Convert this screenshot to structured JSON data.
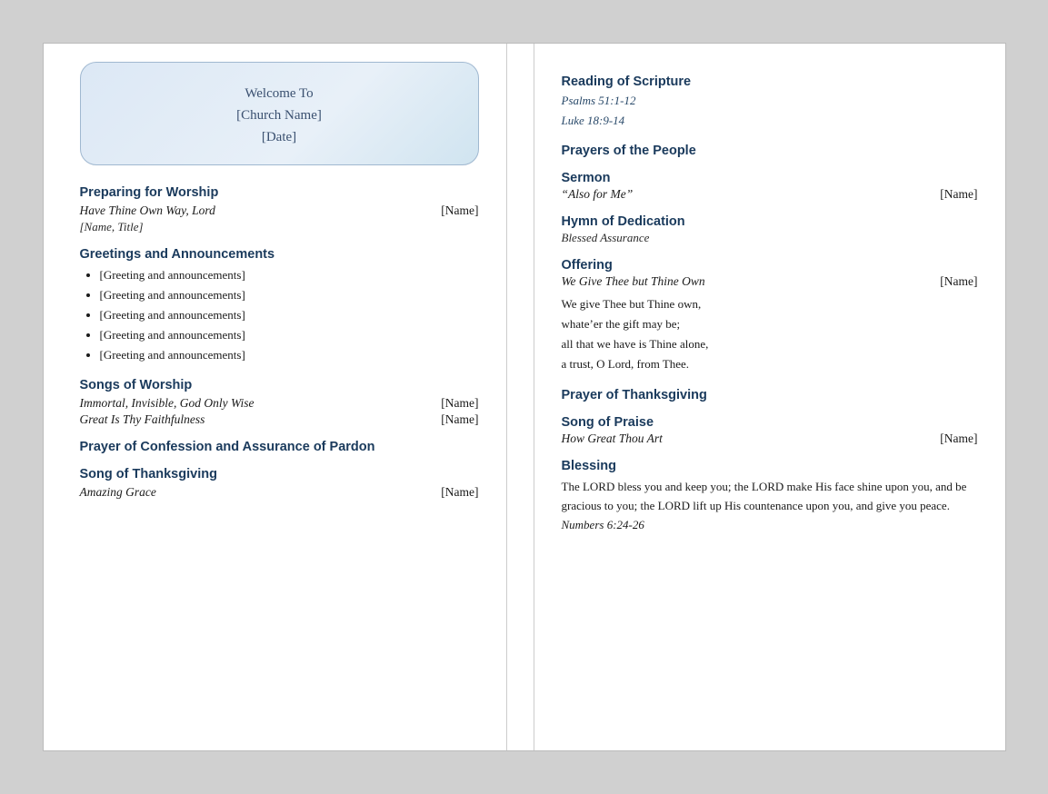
{
  "welcome": {
    "line1": "Welcome To",
    "line2": "[Church Name]",
    "line3": "[Date]"
  },
  "left": {
    "section1": {
      "heading": "Preparing for Worship",
      "song": "Have Thine Own Way, Lord",
      "name": "[Name]",
      "sublabel": "[Name, Title]"
    },
    "section2": {
      "heading": "Greetings and Announcements",
      "bullets": [
        "[Greeting and announcements]",
        "[Greeting and announcements]",
        "[Greeting and announcements]",
        "[Greeting and announcements]",
        "[Greeting and announcements]"
      ]
    },
    "section3": {
      "heading": "Songs of Worship",
      "songs": [
        {
          "name": "Immortal, Invisible, God Only Wise",
          "name_placeholder": "[Name]"
        },
        {
          "name": "Great Is Thy Faithfulness",
          "name_placeholder": "[Name]"
        }
      ]
    },
    "section4": {
      "heading": "Prayer of Confession and Assurance of Pardon"
    },
    "section5": {
      "heading": "Song of Thanksgiving",
      "song": "Amazing Grace",
      "name": "[Name]"
    }
  },
  "right": {
    "section1": {
      "heading": "Reading of Scripture",
      "refs": [
        "Psalms 51:1-12",
        "Luke 18:9-14"
      ]
    },
    "section2": {
      "heading": "Prayers of the People"
    },
    "section3": {
      "heading": "Sermon",
      "title": "“Also for Me”",
      "name": "[Name]"
    },
    "section4": {
      "heading": "Hymn of Dedication",
      "song": "Blessed Assurance"
    },
    "section5": {
      "heading": "Offering",
      "song": "We Give Thee but Thine Own",
      "name": "[Name]",
      "verse": [
        "We give Thee but Thine own,",
        "whate’er the gift may be;",
        "all that we have is Thine alone,",
        "a trust, O Lord, from Thee."
      ]
    },
    "section6": {
      "heading": "Prayer of Thanksgiving"
    },
    "section7": {
      "heading": "Song of Praise",
      "song": "How Great Thou Art",
      "name": "[Name]"
    },
    "section8": {
      "heading": "Blessing",
      "text": "The LORD bless you and keep you; the LORD make His face shine upon you, and be gracious to you; the LORD lift up His countenance upon you, and give you peace.",
      "ref": "Numbers 6:24-26"
    }
  }
}
